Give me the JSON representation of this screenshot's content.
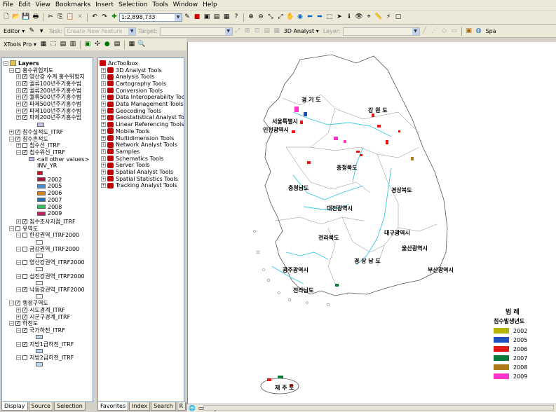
{
  "menu": [
    "File",
    "Edit",
    "View",
    "Bookmarks",
    "Insert",
    "Selection",
    "Tools",
    "Window",
    "Help"
  ],
  "standard_toolbar": {
    "scale": "1:2,898,733"
  },
  "editor_toolbar": {
    "editor_label": "Editor ▾",
    "task_label": "Task:",
    "task_value": "Create New Feature",
    "target_label": "Target:",
    "analyst_label": "3D Analyst ▾",
    "layer_label": "Layer:",
    "spatial_label": "Spa"
  },
  "xtools_toolbar": {
    "label": "XTools Pro ▾"
  },
  "toc": {
    "root": "Layers",
    "rows": [
      {
        "level": 1,
        "exp": "−",
        "chk": "",
        "label": "홍수위험지도"
      },
      {
        "level": 2,
        "exp": "+",
        "chk": "✓",
        "label": "영산강 수계 홍수위험지"
      },
      {
        "level": 2,
        "exp": "+",
        "chk": "✓",
        "label": "궐류100년주기홍수범"
      },
      {
        "level": 2,
        "exp": "+",
        "chk": "✓",
        "label": "궐류200년주기홍수범"
      },
      {
        "level": 2,
        "exp": "+",
        "chk": "✓",
        "label": "궐류500년주기홍수범"
      },
      {
        "level": 2,
        "exp": "+",
        "chk": "✓",
        "label": "파제500년주기홍수범"
      },
      {
        "level": 2,
        "exp": "+",
        "chk": "✓",
        "label": "파제100년주기홍수범"
      },
      {
        "level": 2,
        "exp": "+",
        "chk": "✓",
        "label": "파제200년주기홍수범"
      }
    ],
    "rows2": [
      {
        "level": 1,
        "exp": "+",
        "chk": "✓",
        "label": "침수실적도_ITRF"
      },
      {
        "level": 1,
        "exp": "−",
        "chk": "✓",
        "label": "침수흔적도"
      },
      {
        "level": 2,
        "exp": "+",
        "chk": "",
        "label": "침수선_ITRF"
      },
      {
        "level": 2,
        "exp": "−",
        "chk": "✓",
        "label": "침수위선_ITRF"
      }
    ],
    "other_values": "<all other values>",
    "field": "INV_YR",
    "years": [
      "2002",
      "2005",
      "2006",
      "2007",
      "2008",
      "2009"
    ],
    "rows3": [
      {
        "level": 2,
        "exp": "+",
        "chk": "✓",
        "label": "침수조사지점_ITRF"
      },
      {
        "level": 1,
        "exp": "−",
        "chk": "",
        "label": "유역도"
      },
      {
        "level": 2,
        "exp": "−",
        "chk": "",
        "label": "한강권역_ITRF2000"
      },
      {
        "level": 2,
        "exp": "−",
        "chk": "",
        "label": "금강권역_ITRF2000"
      },
      {
        "level": 2,
        "exp": "−",
        "chk": "",
        "label": "영산강권역_ITRF2000"
      },
      {
        "level": 2,
        "exp": "−",
        "chk": "",
        "label": "섬진강권역_ITRF2000"
      },
      {
        "level": 2,
        "exp": "−",
        "chk": "✓",
        "label": "낙동강권역_ITRF2000"
      },
      {
        "level": 1,
        "exp": "−",
        "chk": "✓",
        "label": "행정구역도"
      },
      {
        "level": 2,
        "exp": "+",
        "chk": "✓",
        "label": "시도경계_ITRF"
      },
      {
        "level": 2,
        "exp": "+",
        "chk": "✓",
        "label": "시군구경계_ITRF"
      },
      {
        "level": 1,
        "exp": "−",
        "chk": "✓",
        "label": "하천도"
      },
      {
        "level": 2,
        "exp": "−",
        "chk": "✓",
        "label": "국가하천_ITRF"
      },
      {
        "level": 2,
        "exp": "−",
        "chk": "✓",
        "label": "지방1급하천_ITRF"
      },
      {
        "level": 2,
        "exp": "−",
        "chk": "",
        "label": "지방2급하천_ITRF"
      }
    ],
    "tabs": [
      "Display",
      "Source",
      "Selection"
    ]
  },
  "toolbox": {
    "root": "ArcToolbox",
    "items": [
      "3D Analyst Tools",
      "Analysis Tools",
      "Cartography Tools",
      "Conversion Tools",
      "Data Interoperability Tools",
      "Data Management Tools",
      "Geocoding Tools",
      "Geostatistical Analyst Tools",
      "Linear Referencing Tools",
      "Mobile Tools",
      "Multidimension Tools",
      "Network Analyst Tools",
      "Samples",
      "Schematics Tools",
      "Server Tools",
      "Spatial Analyst Tools",
      "Spatial Statistics Tools",
      "Tracking Analyst Tools"
    ],
    "tabs": [
      "Favorites",
      "Index",
      "Search",
      "R"
    ]
  },
  "map": {
    "labels": {
      "gyeonggi": "경 기 도",
      "gangwon": "강 원 도",
      "seoul": "서울특별시",
      "incheon": "인천광역시",
      "chungbuk": "충청북도",
      "chungnam": "충청남도",
      "gyeongbuk": "경상북도",
      "daejeon": "대전광역시",
      "daegu": "대구광역시",
      "jeonbuk": "전라북도",
      "ulsan": "울산광역시",
      "gyeongnam": "경 상 남 도",
      "gwangju": "광주광역시",
      "busan": "부산광역시",
      "jeonnam": "전라남도",
      "jeju": "제 주 도"
    },
    "legend": {
      "title": "범 례",
      "subtitle": "침수발생년도",
      "items": [
        {
          "label": "2002",
          "color": "#b5b300"
        },
        {
          "label": "2005",
          "color": "#1f4fbf"
        },
        {
          "label": "2006",
          "color": "#e01818"
        },
        {
          "label": "2007",
          "color": "#0a7a3a"
        },
        {
          "label": "2008",
          "color": "#b07a18"
        },
        {
          "label": "2009",
          "color": "#ff33cc"
        }
      ]
    }
  },
  "toc_swatch_colors": [
    "#c8c0e8",
    "#d01020",
    "#a01838",
    "#4a8ad0",
    "#d08020",
    "#2070b8",
    "#30c060",
    "#e02070",
    "#c02060"
  ]
}
